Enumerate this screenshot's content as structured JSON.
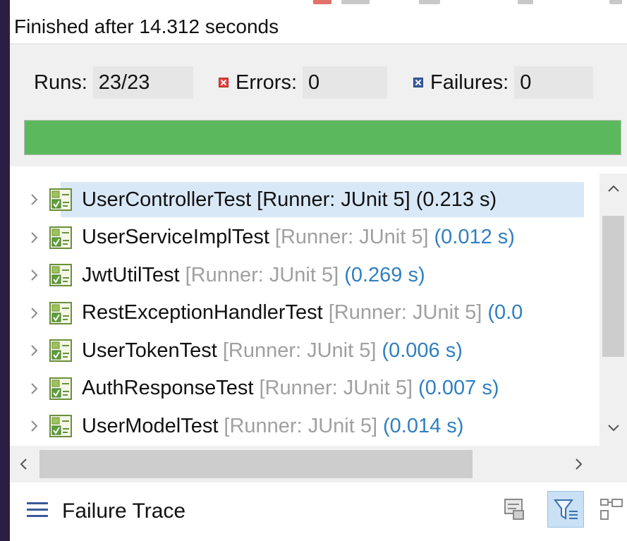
{
  "status": {
    "text": "Finished after 14.312 seconds"
  },
  "counters": {
    "runs_label": "Runs:",
    "runs_value": "23/23",
    "errors_label": "Errors:",
    "errors_value": "0",
    "failures_label": "Failures:",
    "failures_value": "0"
  },
  "progress": {
    "fraction": 1.0,
    "color": "#5cb85c"
  },
  "tests": [
    {
      "name": "UserControllerTest",
      "runner": "[Runner: JUnit 5]",
      "time": "(0.213 s)",
      "selected": true
    },
    {
      "name": "UserServiceImplTest",
      "runner": "[Runner: JUnit 5]",
      "time": "(0.012 s)",
      "selected": false
    },
    {
      "name": "JwtUtilTest",
      "runner": "[Runner: JUnit 5]",
      "time": "(0.269 s)",
      "selected": false
    },
    {
      "name": "RestExceptionHandlerTest",
      "runner": "[Runner: JUnit 5]",
      "time": "(0.0",
      "selected": false
    },
    {
      "name": "UserTokenTest",
      "runner": "[Runner: JUnit 5]",
      "time": "(0.006 s)",
      "selected": false
    },
    {
      "name": "AuthResponseTest",
      "runner": "[Runner: JUnit 5]",
      "time": "(0.007 s)",
      "selected": false
    },
    {
      "name": "UserModelTest",
      "runner": "[Runner: JUnit 5]",
      "time": "(0.014 s)",
      "selected": false
    }
  ],
  "failure_trace": {
    "label": "Failure Trace",
    "icons": [
      "list-icon",
      "compare-results-icon",
      "filter-stack-trace-icon",
      "copy-trace-icon"
    ]
  },
  "colors": {
    "accent": "#2f7fc1",
    "selection": "#d9e8f6",
    "error": "#e0413b",
    "failure": "#3b5fa0"
  }
}
